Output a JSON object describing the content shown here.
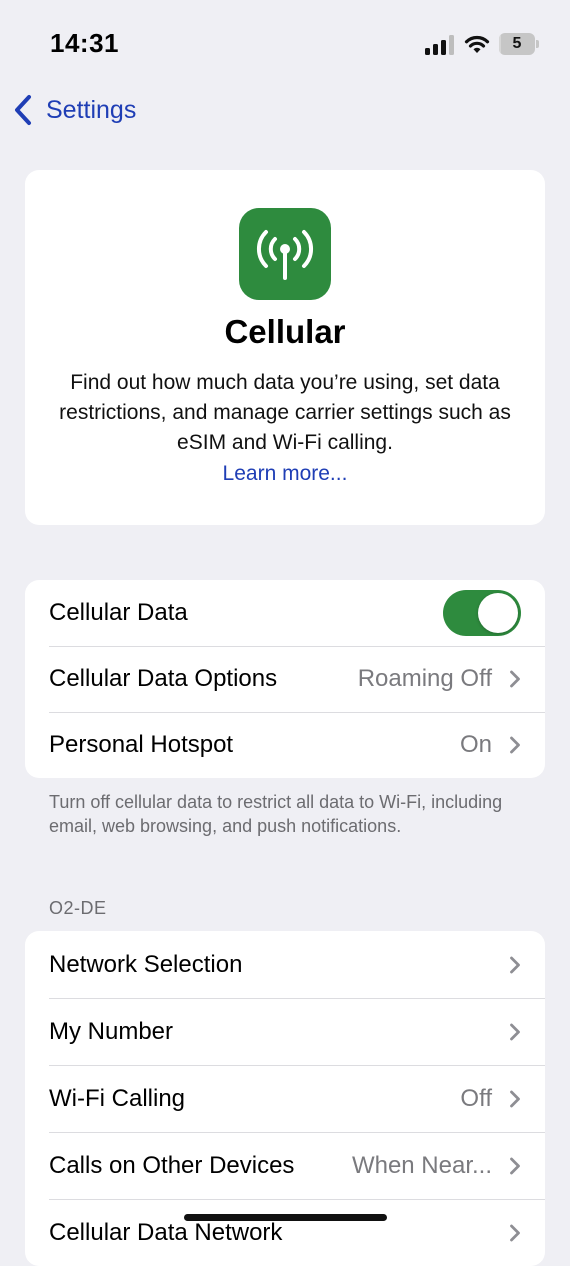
{
  "status_bar": {
    "time": "14:31",
    "battery_level": "5",
    "battery_fraction": 0.05,
    "signal_bars_active": 3,
    "signal_bars_total": 4,
    "icons": [
      "cellular-signal-icon",
      "wifi-icon",
      "battery-icon"
    ]
  },
  "nav": {
    "back_label": "Settings",
    "back_icon": "chevron-left-icon"
  },
  "hero": {
    "icon": "cellular-antenna-icon",
    "icon_color": "#2E8B3E",
    "title": "Cellular",
    "description": "Find out how much data you’re using, set data restrictions, and manage carrier settings such as eSIM and Wi-Fi calling.",
    "learn_more": "Learn more..."
  },
  "data_group": {
    "rows": [
      {
        "title": "Cellular Data",
        "toggle_on": true
      },
      {
        "title": "Cellular Data Options",
        "value": "Roaming Off"
      },
      {
        "title": "Personal Hotspot",
        "value": "On"
      }
    ],
    "footer": "Turn off cellular data to restrict all data to Wi-Fi, including email, web browsing, and push notifications."
  },
  "carrier_group": {
    "header": "O2-DE",
    "rows": [
      {
        "title": "Network Selection",
        "value": ""
      },
      {
        "title": "My Number",
        "value": ""
      },
      {
        "title": "Wi-Fi Calling",
        "value": "Off"
      },
      {
        "title": "Calls on Other Devices",
        "value": "When Near..."
      },
      {
        "title": "Cellular Data Network",
        "value": ""
      }
    ]
  },
  "colors": {
    "accent": "#1F3EB5",
    "toggle_on": "#2E8B3E",
    "background": "#EFEFF4",
    "secondary_text": "#7a7a7e"
  }
}
